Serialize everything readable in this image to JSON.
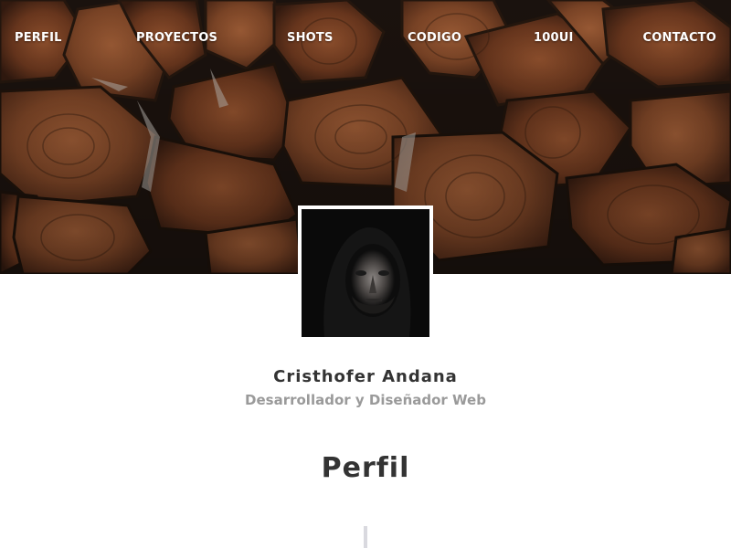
{
  "nav": {
    "items": [
      {
        "label": "PERFIL"
      },
      {
        "label": "PROYECTOS"
      },
      {
        "label": "SHOTS"
      },
      {
        "label": "CODIGO"
      },
      {
        "label": "100UI"
      },
      {
        "label": "CONTACTO"
      }
    ]
  },
  "profile": {
    "name": "Cristhofer Andana",
    "role": "Desarrollador y Diseñador Web"
  },
  "section": {
    "title": "Perfil"
  },
  "colors": {
    "heading": "#333333",
    "subtitle": "#9a9a9a",
    "nav_text": "#ffffff",
    "divider": "#d9d9df"
  },
  "icons": {
    "hero": "woodpile-photo",
    "avatar": "profile-photo"
  }
}
